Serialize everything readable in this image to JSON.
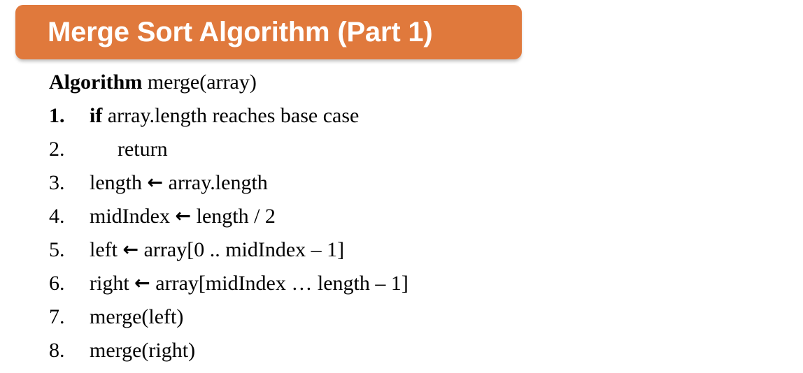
{
  "slide": {
    "title": "Merge Sort Algorithm (Part 1)",
    "banner_color": "#e0793c",
    "title_color": "#ffffff",
    "background_color": "#ffffff",
    "text_color": "#000000"
  },
  "algorithm": {
    "signature": {
      "keyword": "Algorithm",
      "name": "merge(array)"
    },
    "steps": [
      {
        "number": "1.",
        "number_bold": true,
        "keyword": "if",
        "text": " array.length reaches base case",
        "indent": "normal"
      },
      {
        "number": "2.",
        "number_bold": false,
        "keyword": "",
        "text": "return",
        "indent": "extra"
      },
      {
        "number": "3.",
        "number_bold": false,
        "keyword": "",
        "text": "length ← array.length",
        "indent": "normal"
      },
      {
        "number": "4.",
        "number_bold": false,
        "keyword": "",
        "text": "midIndex ← length / 2",
        "indent": "normal"
      },
      {
        "number": "5.",
        "number_bold": false,
        "keyword": "",
        "text": "left ← array[0 .. midIndex – 1]",
        "indent": "normal"
      },
      {
        "number": "6.",
        "number_bold": false,
        "keyword": "",
        "text": "right ← array[midIndex … length – 1]",
        "indent": "normal"
      },
      {
        "number": "7.",
        "number_bold": false,
        "keyword": "",
        "text": "merge(left)",
        "indent": "normal"
      },
      {
        "number": "8.",
        "number_bold": false,
        "keyword": "",
        "text": "merge(right)",
        "indent": "normal"
      }
    ]
  }
}
